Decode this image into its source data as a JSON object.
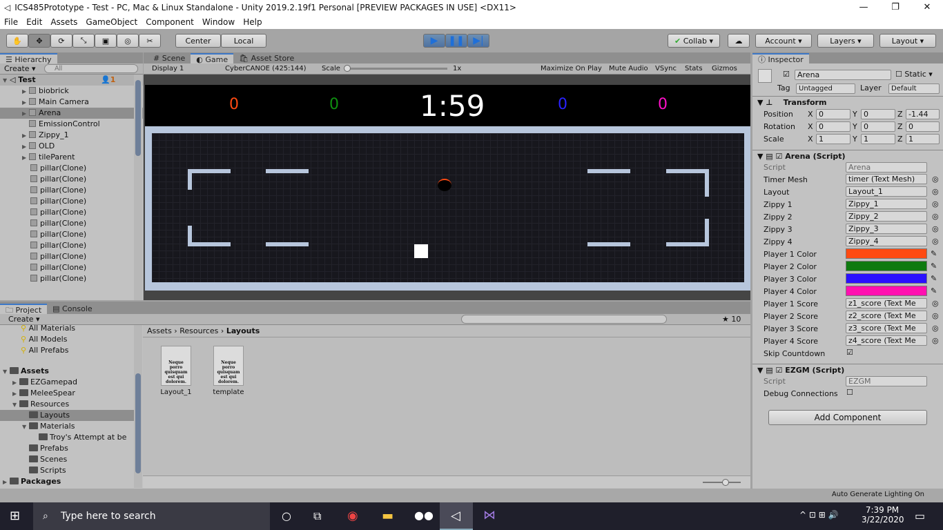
{
  "window": {
    "title": "ICS485Prototype - Test - PC, Mac & Linux Standalone - Unity 2019.2.19f1 Personal [PREVIEW PACKAGES IN USE] <DX11>"
  },
  "menu": [
    "File",
    "Edit",
    "Assets",
    "GameObject",
    "Component",
    "Window",
    "Help"
  ],
  "toolbar": {
    "pivot": "Center",
    "space": "Local",
    "collab": "Collab",
    "account": "Account",
    "layers": "Layers",
    "layout": "Layout"
  },
  "hierarchy": {
    "tab": "Hierarchy",
    "create": "Create",
    "search_placeholder": "All",
    "scene": "Test",
    "scene_badge": "1",
    "items": [
      "biobrick",
      "Main Camera",
      "Arena",
      "EmissionControl",
      "Zippy_1",
      "OLD",
      "tileParent",
      "pillar(Clone)",
      "pillar(Clone)",
      "pillar(Clone)",
      "pillar(Clone)",
      "pillar(Clone)",
      "pillar(Clone)",
      "pillar(Clone)",
      "pillar(Clone)",
      "pillar(Clone)",
      "pillar(Clone)",
      "pillar(Clone)"
    ]
  },
  "game": {
    "tabs": [
      "Scene",
      "Game",
      "Asset Store"
    ],
    "display": "Display 1",
    "resolution": "CyberCANOE (425:144)",
    "scale_label": "Scale",
    "scale_value": "1x",
    "options": [
      "Maximize On Play",
      "Mute Audio",
      "VSync",
      "Stats",
      "Gizmos"
    ],
    "scores": [
      "0",
      "0",
      "0",
      "0"
    ],
    "score_colors": [
      "#ff4a12",
      "#0f8f10",
      "#2a22ff",
      "#ff10c8"
    ],
    "timer": "1:59"
  },
  "project": {
    "tabs": [
      "Project",
      "Console"
    ],
    "create": "Create",
    "favorites": [
      "All Materials",
      "All Models",
      "All Prefabs"
    ],
    "tree": [
      "Assets",
      "EZGamepad",
      "MeleeSpear",
      "Resources",
      "Layouts",
      "Materials",
      "Troy's Attempt at be",
      "Prefabs",
      "Scenes",
      "Scripts",
      "Packages"
    ],
    "breadcrumb": [
      "Assets",
      "Resources",
      "Layouts"
    ],
    "files": [
      "Layout_1",
      "template"
    ],
    "file_preview": "Neque porro quisquam est qui dolorem.",
    "hidden_count": "10"
  },
  "inspector": {
    "tab": "Inspector",
    "name": "Arena",
    "static": "Static",
    "tag_label": "Tag",
    "tag": "Untagged",
    "layer_label": "Layer",
    "layer": "Default",
    "transform": {
      "title": "Transform",
      "rows": [
        {
          "label": "Position",
          "x": "0",
          "y": "0",
          "z": "-1.44"
        },
        {
          "label": "Rotation",
          "x": "0",
          "y": "0",
          "z": "0"
        },
        {
          "label": "Scale",
          "x": "1",
          "y": "1",
          "z": "1"
        }
      ]
    },
    "arena": {
      "title": "Arena (Script)",
      "script_label": "Script",
      "script": "Arena",
      "refs": [
        {
          "label": "Timer Mesh",
          "value": "timer (Text Mesh)"
        },
        {
          "label": "Layout",
          "value": "Layout_1"
        },
        {
          "label": "Zippy 1",
          "value": "Zippy_1"
        },
        {
          "label": "Zippy 2",
          "value": "Zippy_2"
        },
        {
          "label": "Zippy 3",
          "value": "Zippy_3"
        },
        {
          "label": "Zippy 4",
          "value": "Zippy_4"
        }
      ],
      "colors": [
        {
          "label": "Player 1 Color",
          "value": "#ff4a12"
        },
        {
          "label": "Player 2 Color",
          "value": "#0f7a10"
        },
        {
          "label": "Player 3 Color",
          "value": "#2a10ff"
        },
        {
          "label": "Player 4 Color",
          "value": "#ff10b0"
        }
      ],
      "scores": [
        {
          "label": "Player 1 Score",
          "value": "z1_score (Text Me"
        },
        {
          "label": "Player 2 Score",
          "value": "z2_score (Text Me"
        },
        {
          "label": "Player 3 Score",
          "value": "z3_score (Text Me"
        },
        {
          "label": "Player 4 Score",
          "value": "z4_score (Text Me"
        }
      ],
      "skip_label": "Skip Countdown"
    },
    "ezgm": {
      "title": "EZGM (Script)",
      "script_label": "Script",
      "script": "EZGM",
      "debug_label": "Debug Connections"
    },
    "add_component": "Add Component"
  },
  "status": {
    "text": "Auto Generate Lighting On"
  },
  "taskbar": {
    "search": "Type here to search",
    "time": "7:39 PM",
    "date": "3/22/2020"
  }
}
